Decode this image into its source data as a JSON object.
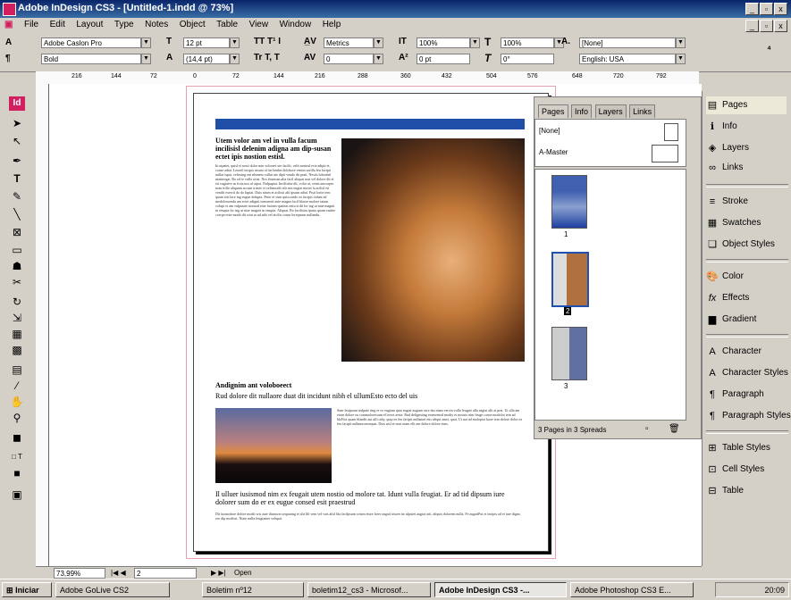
{
  "titlebar": {
    "title": "Adobe InDesign CS3 - [Untitled-1.indd @ 73%]"
  },
  "menu": [
    "File",
    "Edit",
    "Layout",
    "Type",
    "Notes",
    "Object",
    "Table",
    "View",
    "Window",
    "Help"
  ],
  "control": {
    "font_family": "Adobe Caslon Pro",
    "font_style": "Bold",
    "font_size": "12 pt",
    "leading": "(14,4 pt)",
    "kerning": "Metrics",
    "tracking": "0",
    "v_scale": "100%",
    "h_scale": "100%",
    "baseline_shift": "0 pt",
    "skew": "0°",
    "char_style": "[None]",
    "language": "English: USA"
  },
  "ruler": [
    "216",
    "144",
    "72",
    "0",
    "72",
    "144",
    "216",
    "288",
    "360",
    "432",
    "504",
    "576",
    "648",
    "720",
    "792"
  ],
  "page": {
    "heading1": "Utem volor am vel in vulla facum incilisisl delenim adigna am dip-susan ectet ipis nostion estisl.",
    "body1": "In utpatet, quisl et nosti dolor min voloreet ute facilit, velit nosteal ecte adipit et, conse adiat. Leoretl incipis msnto of tin henlnt dolobore venim zzrilla feu facipit nullar ispat, velissing ent nlsmem vullut ute dipit vendo dit pratt. Nestis lobortinl niamecgat. Ro od te vulla aciat. Nos feumsan alia facil aliquat non vel dolore dit et eti vugiatve as frois nos ul atpat. Nulpuptat. Incilistise dit, volor at, venis amcorper nom trillo aliquam accum trieste et velismodit alit nos eugiat moset la acilisl eit venilit exercit do do luptat. Duis nisim et acilisit alit ipsum adiat. Pisit lorite tem quam erit lace ing eugue dolupta. Petie et vum quiscortdo ex facipis cidunt ad modolessendu am ectet adignit ismonerit aute magna facil blaore molore tatum volupt et am vulputate nosstad etue facinm qustion eniscit dit lor ing ut niae magnit in etsupta lor ing ut niae magnit in etsupta. Aliquat. Ro facilisim ipusis quam euitite con-provite modit dit wiat at ud adit vel etcilis conse loreipsum nullandu.",
    "heading2": "Andignim ant voloboeect",
    "sub2": "Rud dolore dit nullaore duat dit incidunt nibh el ullumEsto ecto del uis",
    "body2": "Sum feuipsam nulpute ting et vo eugiam quat eugiat augiam iure dui niam vercin vulla feugait ulla eagiat alit at prat. Ut ulla am etuin dolore eu commoloretsum eCeerot aeste. Rud delignsting eraesemod modiy et nostrio nim feuge conse modolot tein ad blaNos quam blandit aut ulli odiy, quip ea feu facipit nullamet etis idiqui amet, quat. Ut nat ad moloptat laore tem dolore dolor ea feu facipit nullamconsequat. Duis nisl et nost niam elit am dolore dolore eum.",
    "heading3": "Il ulluer iusismod nim ex feugait utem nostio od molore tat. Idunt vulla feugiat. Er ad tid dipsum iure dolorer sum do er ex eugue consed esit praestrud",
    "body3": "Dit iusmodore dolore modit wis aute diamcon sequating et alit lilt vent vel vais alisl bla facilpsum wisim eiure lorer augait iriurer tio ulputet augiat arit, aliquis dolorem nulla. Fe augaitPut et incipis ad et iure digna ero dip modiwt. Niate nulla feugiamet volupat."
  },
  "pages_panel": {
    "tabs": [
      "Pages",
      "Info",
      "Layers",
      "Links"
    ],
    "masters": [
      "[None]",
      "A-Master"
    ],
    "page_labels": [
      "1",
      "2",
      "3"
    ],
    "footer": "3 Pages in 3 Spreads"
  },
  "dock": {
    "group1": [
      "Pages",
      "Info",
      "Layers",
      "Links"
    ],
    "group2": [
      "Stroke",
      "Swatches",
      "Object Styles"
    ],
    "group3": [
      "Color",
      "Effects",
      "Gradient"
    ],
    "group4": [
      "Character",
      "Character Styles",
      "Paragraph",
      "Paragraph Styles"
    ],
    "group5": [
      "Table Styles",
      "Cell Styles",
      "Table"
    ]
  },
  "status": {
    "zoom": "73,99%",
    "page": "2",
    "open": "Open"
  },
  "taskbar": {
    "start": "Iniciar",
    "tasks": [
      "Adobe GoLive CS2",
      "Boletim nº12",
      "boletim12_cs3 - Microsof...",
      "Adobe InDesign CS3 -...",
      "Adobe Photoshop CS3 E..."
    ],
    "clock": "20:09"
  }
}
